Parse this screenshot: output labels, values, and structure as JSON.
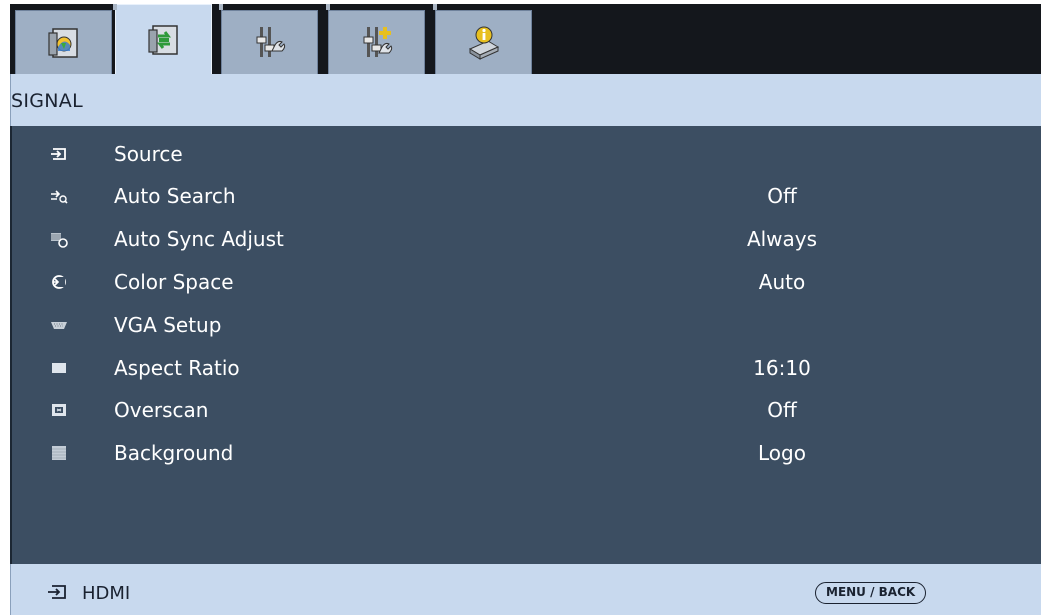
{
  "tabs": [
    {
      "icon": "display-image-icon",
      "active": false
    },
    {
      "icon": "display-signal-icon",
      "active": true
    },
    {
      "icon": "setting-wrench-icon",
      "active": false
    },
    {
      "icon": "advanced-setting-icon",
      "active": false
    },
    {
      "icon": "information-icon",
      "active": false
    }
  ],
  "section": {
    "title": "SIGNAL"
  },
  "menu": {
    "items": [
      {
        "label": "Source",
        "value": "",
        "icon": "source-input-icon"
      },
      {
        "label": "Auto Search",
        "value": "Off",
        "icon": "auto-search-icon"
      },
      {
        "label": "Auto Sync Adjust",
        "value": "Always",
        "icon": "auto-sync-icon"
      },
      {
        "label": "Color Space",
        "value": "Auto",
        "icon": "color-space-icon"
      },
      {
        "label": "VGA Setup",
        "value": "",
        "icon": "vga-connector-icon"
      },
      {
        "label": "Aspect Ratio",
        "value": "16:10",
        "icon": "aspect-ratio-icon"
      },
      {
        "label": "Overscan",
        "value": "Off",
        "icon": "overscan-icon"
      },
      {
        "label": "Background",
        "value": "Logo",
        "icon": "background-icon"
      }
    ]
  },
  "footer": {
    "source": "HDMI",
    "menu_back": "MENU / BACK",
    "icon": "source-input-icon"
  },
  "colors": {
    "header_bg": "#c8d9ee",
    "panel_bg": "#3c4e62",
    "tabbar_bg": "#14171c",
    "tab_inactive": "#9eafc4"
  }
}
